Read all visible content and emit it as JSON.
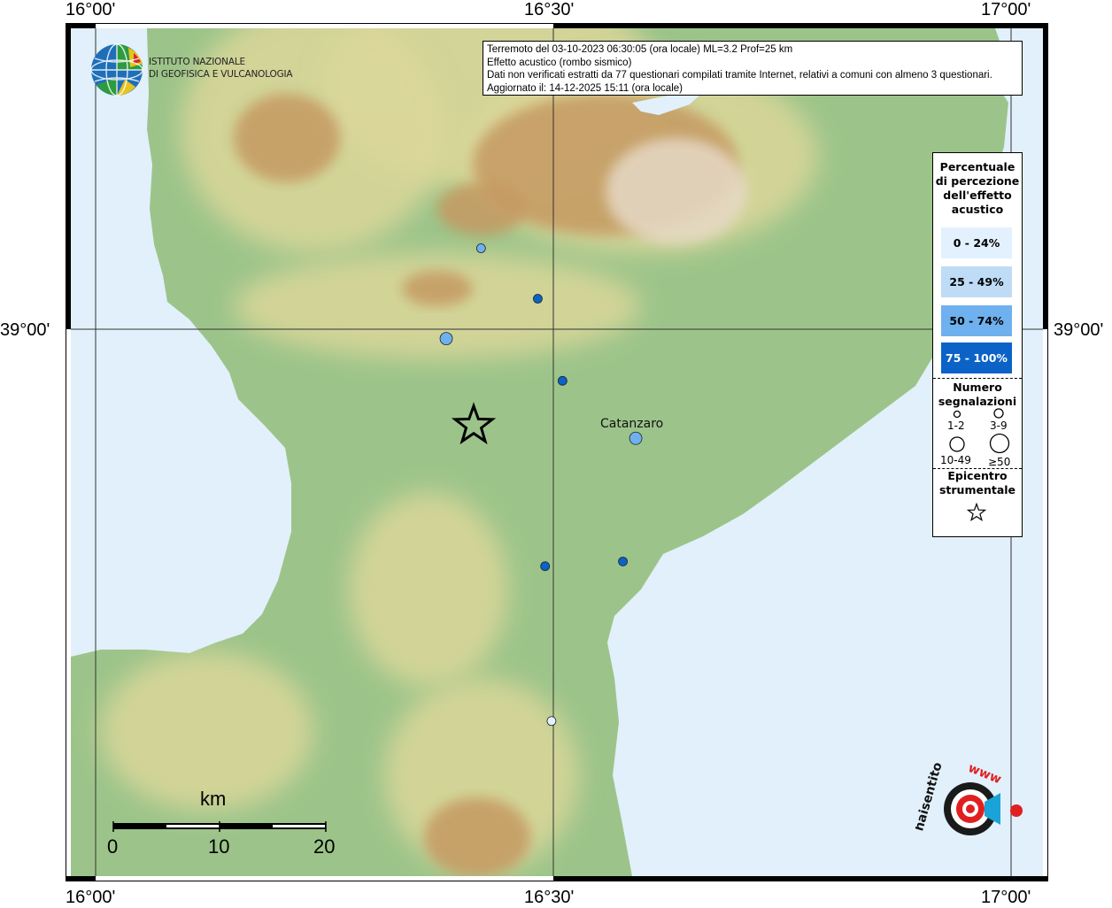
{
  "coords": {
    "lon_left": "16°00'",
    "lon_mid": "16°30'",
    "lon_right": "17°00'",
    "lat_mid": "39°00'"
  },
  "institute": {
    "line1": "ISTITUTO NAZIONALE",
    "line2": "DI GEOFISICA E VULCANOLOGIA"
  },
  "info": {
    "line1": "Terremoto del 03-10-2023 06:30:05 (ora locale) ML=3.2 Prof=25 km",
    "line2": "Effetto acustico (rombo sismico)",
    "line3": "Dati non verificati estratti da 77 questionari compilati tramite Internet, relativi a comuni con almeno 3 questionari.",
    "line4": "Aggiornato il: 14-12-2025 15:11 (ora locale)"
  },
  "legend": {
    "title": [
      "Percentuale",
      "di percezione",
      "dell'effetto",
      "acustico"
    ],
    "classes": [
      {
        "label": "0 - 24%",
        "color": "#e2f1fd",
        "text_color": "#000000"
      },
      {
        "label": "25 - 49%",
        "color": "#bfdcf7",
        "text_color": "#000000"
      },
      {
        "label": "50 - 74%",
        "color": "#6fb1ee",
        "text_color": "#000000"
      },
      {
        "label": "75 - 100%",
        "color": "#0b63c8",
        "text_color": "#ffffff"
      }
    ],
    "count_title": [
      "Numero",
      "segnalazioni"
    ],
    "counts": [
      "1-2",
      "3-9",
      "10-49",
      "≥50"
    ],
    "epicenter_title": [
      "Epicentro",
      "strumentale"
    ]
  },
  "city": {
    "name": "Catanzaro"
  },
  "scale": {
    "unit": "km",
    "ticks": [
      "0",
      "10",
      "20"
    ]
  },
  "points": [
    {
      "lon": 16.421,
      "lat": 39.069,
      "pct_class": 2,
      "size_class": 0
    },
    {
      "lon": 16.483,
      "lat": 39.026,
      "pct_class": 3,
      "size_class": 0
    },
    {
      "lon": 16.383,
      "lat": 38.992,
      "pct_class": 2,
      "size_class": 1
    },
    {
      "lon": 16.51,
      "lat": 38.956,
      "pct_class": 3,
      "size_class": 0
    },
    {
      "lon": 16.59,
      "lat": 38.907,
      "pct_class": 2,
      "size_class": 1
    },
    {
      "lon": 16.491,
      "lat": 38.798,
      "pct_class": 3,
      "size_class": 0
    },
    {
      "lon": 16.576,
      "lat": 38.802,
      "pct_class": 3,
      "size_class": 0
    },
    {
      "lon": 16.498,
      "lat": 38.666,
      "pct_class": 0,
      "size_class": 0
    }
  ],
  "epicenter": {
    "lon": 16.413,
    "lat": 38.918
  },
  "colors": {
    "sea": "#e1f0fb",
    "lowland": "#9cc48a",
    "hill": "#dcd79a",
    "mountain": "#c59a62",
    "peak": "#e6d9c6",
    "frame": "#000000"
  },
  "logos": {
    "site": "www.haisentitoilterremoto.it"
  }
}
